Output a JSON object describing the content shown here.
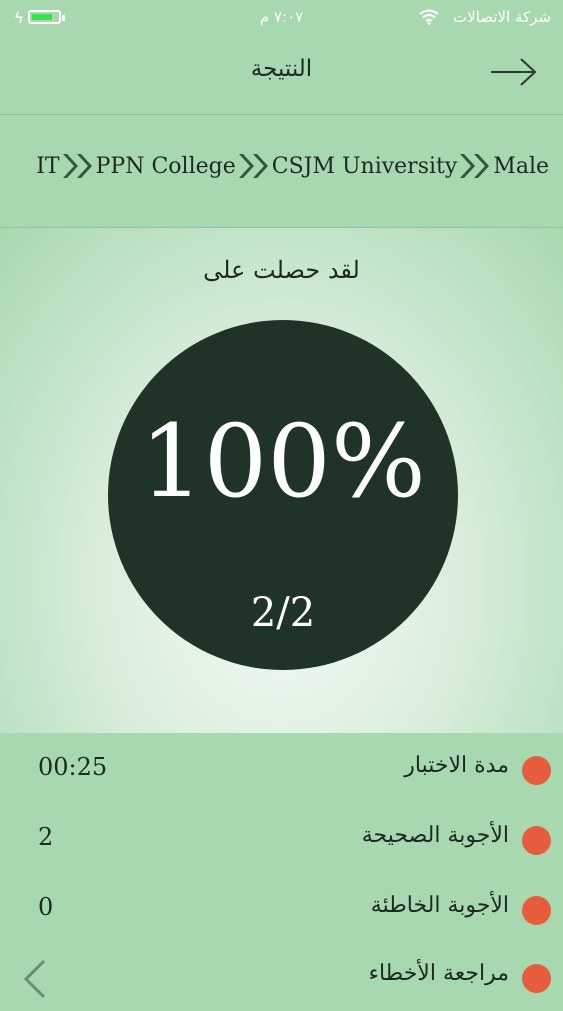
{
  "status_bar": {
    "carrier": "شركة الاتصالات",
    "time": "٧:٠٧ م",
    "battery_level": 0.8
  },
  "header": {
    "title": "النتيجة"
  },
  "breadcrumb": {
    "items": [
      "IT",
      "PPN College",
      "CSJM University",
      "Male"
    ]
  },
  "result": {
    "heading": "لقد حصلت على",
    "percent": "100%",
    "fraction": "2/2"
  },
  "stats": [
    {
      "label": "مدة الاختبار",
      "value": "00:25"
    },
    {
      "label": "الأجوبة الصحيحة",
      "value": "2"
    },
    {
      "label": "الأجوبة الخاطئة",
      "value": "0"
    },
    {
      "label": "مراجعة الأخطاء",
      "value": ""
    }
  ],
  "colors": {
    "background": "#a8d8b0",
    "circle": "#1f3326",
    "dot": "#e85c3e",
    "battery": "#3be04a"
  }
}
